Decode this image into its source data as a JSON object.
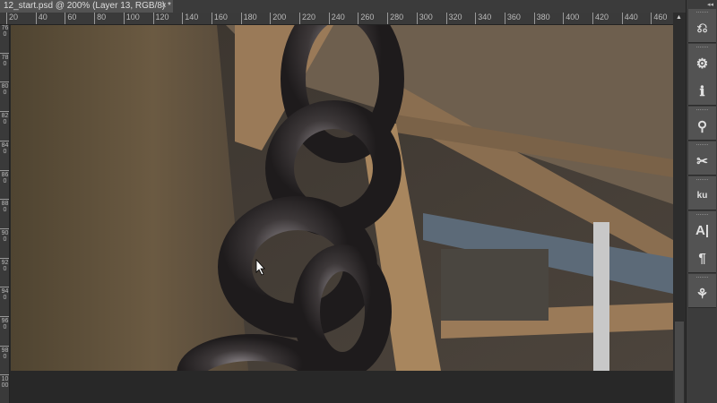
{
  "document": {
    "tab_title": "12_start.psd @ 200% (Layer 13, RGB/8) *",
    "close_glyph": "×"
  },
  "rulers": {
    "horizontal": [
      "20",
      "40",
      "60",
      "80",
      "100",
      "120",
      "140",
      "160",
      "180",
      "200",
      "220",
      "240",
      "260",
      "280",
      "300",
      "320",
      "340",
      "360",
      "380",
      "400",
      "420",
      "440",
      "460"
    ],
    "vertical": [
      "760",
      "780",
      "800",
      "820",
      "840",
      "860",
      "880",
      "900",
      "920",
      "940",
      "960",
      "980",
      "1000"
    ]
  },
  "panel": {
    "collapse_glyph": "◂◂",
    "groups": [
      {
        "icons": [
          {
            "name": "history-icon",
            "glyph": "⎌"
          }
        ]
      },
      {
        "icons": [
          {
            "name": "properties-icon",
            "glyph": "⚙"
          },
          {
            "name": "info-icon",
            "glyph": "ℹ"
          }
        ]
      },
      {
        "icons": [
          {
            "name": "brush-presets-icon",
            "glyph": "⚲"
          }
        ]
      },
      {
        "icons": [
          {
            "name": "tool-presets-icon",
            "glyph": "✂"
          }
        ]
      },
      {
        "icons": [
          {
            "name": "kuler-icon",
            "glyph": "ku"
          }
        ]
      },
      {
        "icons": [
          {
            "name": "character-icon",
            "glyph": "A|"
          },
          {
            "name": "paragraph-icon",
            "glyph": "¶"
          }
        ]
      },
      {
        "icons": [
          {
            "name": "clone-source-icon",
            "glyph": "⚘"
          }
        ]
      }
    ]
  }
}
